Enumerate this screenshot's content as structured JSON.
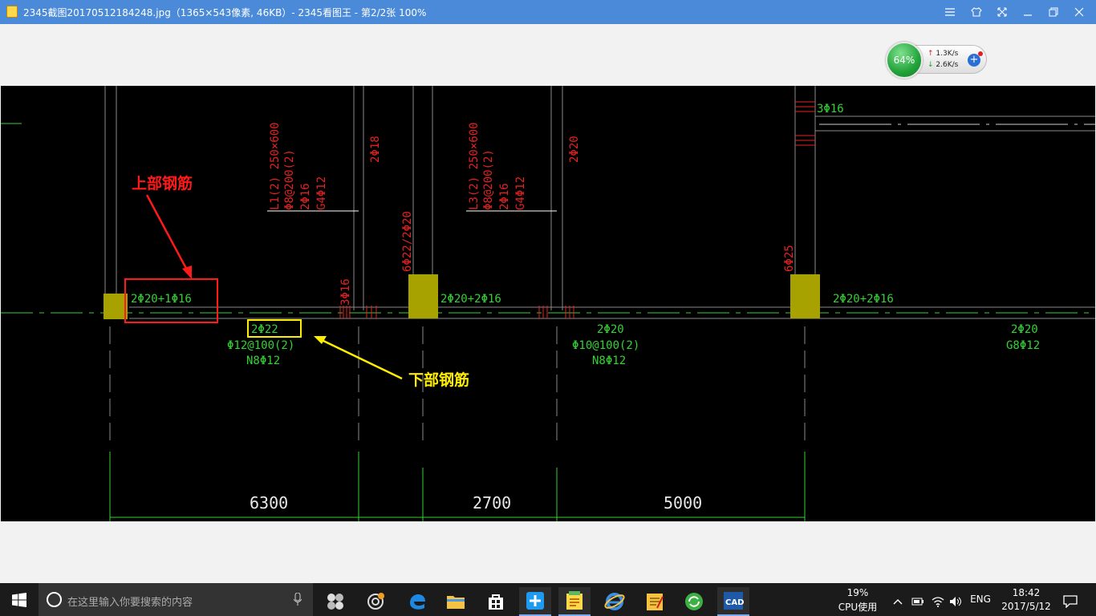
{
  "window": {
    "title": "2345截图20170512184248.jpg（1365×543像素, 46KB）- 2345看图王 - 第2/2张 100%",
    "controls": [
      "menu-icon",
      "skin-icon",
      "fullscreen-icon",
      "minimize-icon",
      "restore-icon",
      "close-icon"
    ]
  },
  "net_widget": {
    "cpu_percent": "64%",
    "upload": "1.3K/s",
    "download": "2.6K/s"
  },
  "drawing": {
    "annotation_top": "上部钢筋",
    "annotation_bottom": "下部钢筋",
    "beam_L1": [
      "L1(2) 250×600",
      "Φ8@200(2)",
      "2Φ16",
      "G4Φ12"
    ],
    "beam_L3": [
      "L3(2) 250×600",
      "Φ8@200(2)",
      "2Φ16",
      "G4Φ12"
    ],
    "vertical_labels": [
      "2Φ18",
      "2Φ20",
      "6Φ22/2Φ20",
      "3Φ16",
      "6Φ25"
    ],
    "top_rebar": [
      "2Φ20+1Φ16",
      "2Φ20+2Φ16",
      "2Φ20+2Φ16",
      "3Φ16"
    ],
    "span1": [
      "2Φ22",
      "Φ12@100(2)",
      "N8Φ12"
    ],
    "span2": [
      "2Φ20",
      "Φ10@100(2)",
      "N8Φ12"
    ],
    "span3": [
      "2Φ20",
      "G8Φ12"
    ],
    "dimensions": [
      "6300",
      "2700",
      "5000"
    ]
  },
  "taskbar": {
    "search_placeholder": "在这里输入你要搜索的内容",
    "cpu_usage": "19%",
    "cpu_label": "CPU使用",
    "language": "ENG",
    "time": "18:42",
    "date": "2017/5/12"
  },
  "colors": {
    "titlebar": "#4a8ad8",
    "cad_green": "#35d235",
    "cad_red": "#e42222",
    "annot_red": "#ff1a1a",
    "annot_yellow": "#ffee00",
    "column_fill": "#a8a200"
  }
}
